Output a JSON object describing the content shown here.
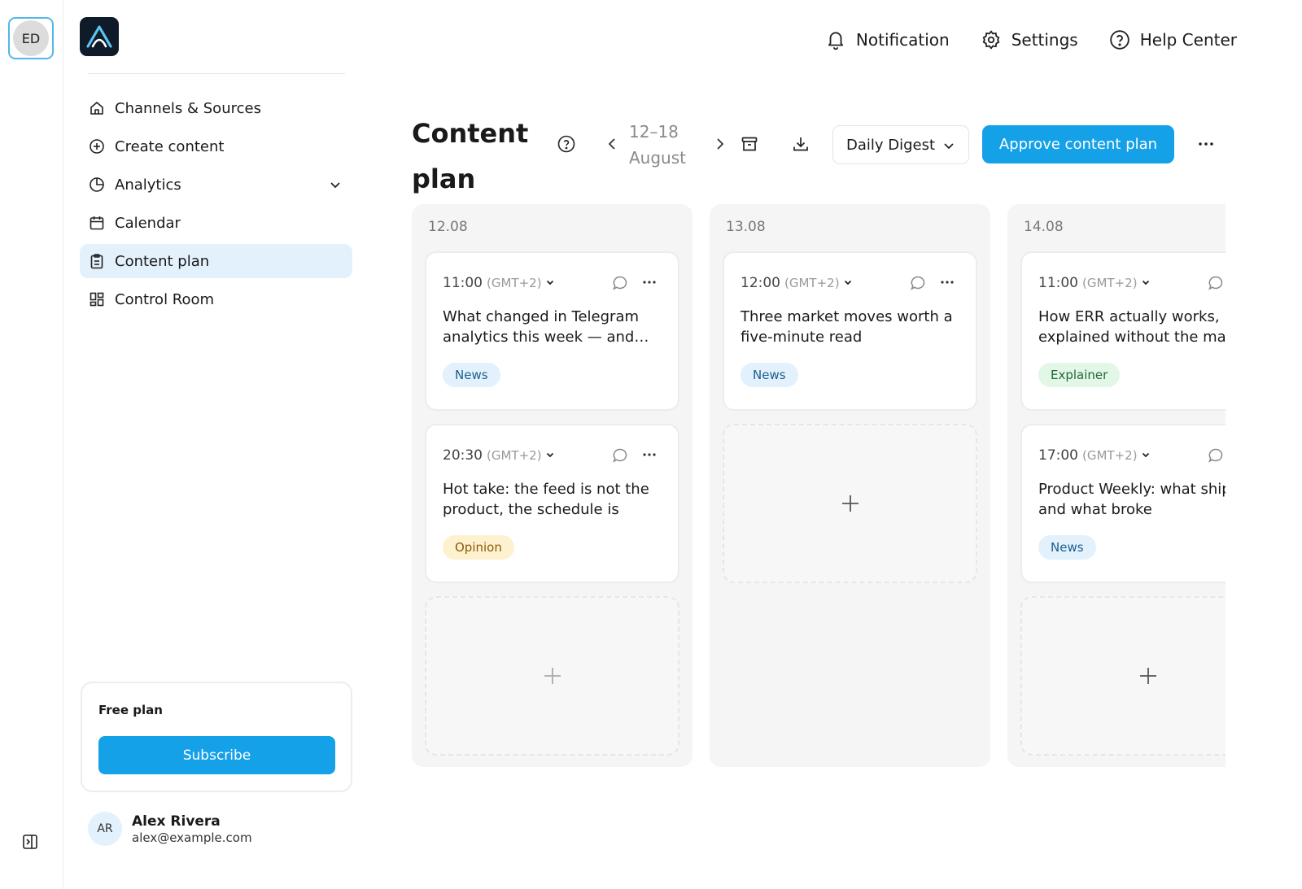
{
  "workspace": {
    "initials": "ED"
  },
  "nav": [
    {
      "label": "Channels & Sources",
      "icon": "home-icon"
    },
    {
      "label": "Create content",
      "icon": "plus-circle-icon"
    },
    {
      "label": "Analytics",
      "icon": "pie-chart-icon"
    },
    {
      "label": "Calendar",
      "icon": "calendar-icon"
    },
    {
      "label": "Content plan",
      "icon": "clipboard-icon",
      "active": true
    },
    {
      "label": "Control Room",
      "icon": "dashboard-icon"
    }
  ],
  "plan": {
    "title": "Free plan",
    "subscribe_label": "Subscribe"
  },
  "user": {
    "initials": "AR",
    "name": "Alex Rivera",
    "email": "alex@example.com"
  },
  "header": {
    "notification": "Notification",
    "settings": "Settings",
    "help": "Help Center"
  },
  "content": {
    "title": "Content plan",
    "week_label": "12–18 August",
    "digest": "Daily Digest",
    "approve_label": "Approve content plan"
  },
  "accent_color": "#14a1e8",
  "days": [
    {
      "date": "12.08",
      "posts": [
        {
          "time": "11:00",
          "tz": "(GMT+2)",
          "text": "What changed in Telegram\nanalytics this week — and…",
          "tag": "News"
        },
        {
          "time": "20:30",
          "tz": "(GMT+2)",
          "text": "Hot take: the feed is not the\nproduct, the schedule is",
          "tag": "Opinion"
        }
      ]
    },
    {
      "date": "13.08",
      "posts": [
        {
          "time": "12:00",
          "tz": "(GMT+2)",
          "text": "Three market moves worth a\nfive-minute read",
          "tag": "News"
        }
      ]
    },
    {
      "date": "14.08",
      "posts": [
        {
          "time": "11:00",
          "tz": "(GMT+2)",
          "text": "How ERR actually works,\nexplained without the mat",
          "tag": "Explainer"
        },
        {
          "time": "17:00",
          "tz": "(GMT+2)",
          "text": "Product Weekly: what ship\nand what broke",
          "tag": "News"
        }
      ]
    }
  ]
}
